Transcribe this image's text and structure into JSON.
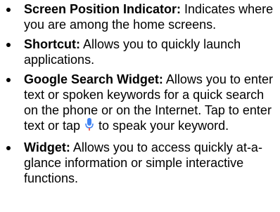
{
  "items": [
    {
      "term": "Screen Position Indicator:",
      "text": " Indicates where you are among the home screens."
    },
    {
      "term": "Shortcut:",
      "text": " Allows you to quickly launch applications."
    },
    {
      "term": "Google Search Widget:",
      "text": " Allows you to enter text or spoken keywords for a quick search on the phone or on the Internet. Tap to enter text or tap ",
      "icon": "microphone-icon",
      "text_after": " to speak your keyword."
    },
    {
      "term": "Widget:",
      "text": " Allows you to access quickly at-a-glance information or simple interactive functions."
    }
  ],
  "colors": {
    "text": "#000000",
    "mic_icon": "#4285F4",
    "mic_icon_bottom": "#EA4335"
  }
}
